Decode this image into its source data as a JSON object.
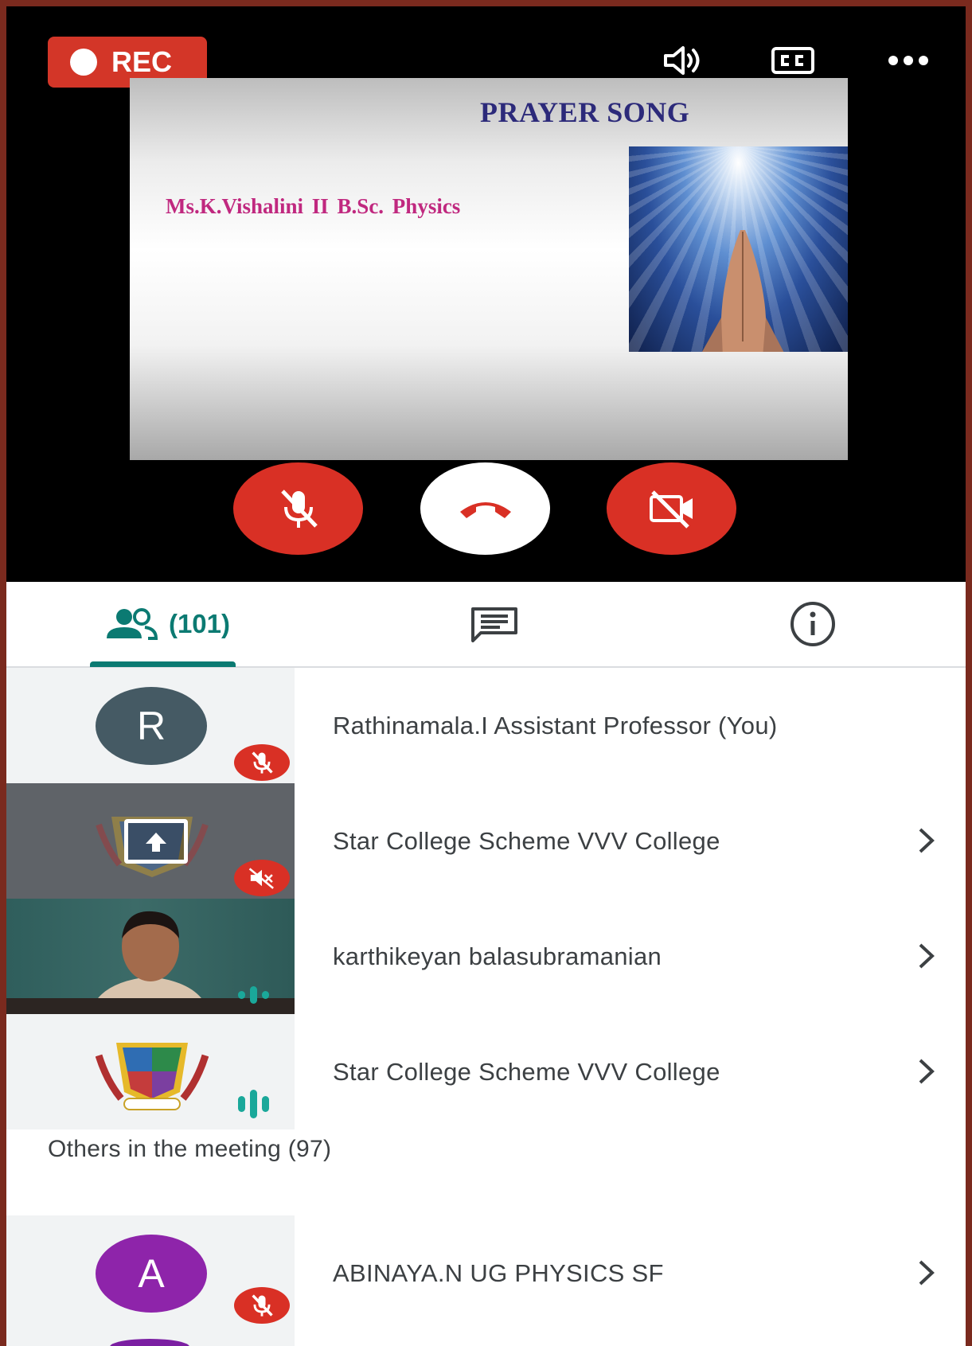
{
  "recording": {
    "label": "REC"
  },
  "slide": {
    "title": "PRAYER SONG",
    "subtitle": "Ms.K.Vishalini  II B.Sc. Physics"
  },
  "tabs": {
    "people_count": "(101)"
  },
  "participants": [
    {
      "initial": "R",
      "name": "Rathinamala.I Assistant Professor (You)",
      "avatar_color": "#455a64",
      "status": "muted"
    },
    {
      "name": "Star College Scheme VVV College",
      "status": "audio-off",
      "presenting": true
    },
    {
      "name": "karthikeyan balasubramanian",
      "status": "speaking"
    },
    {
      "name": "Star College Scheme VVV College",
      "status": "speaking"
    }
  ],
  "others": {
    "heading": "Others in the meeting (97)",
    "items": [
      {
        "initial": "A",
        "name": "ABINAYA.N UG PHYSICS SF",
        "avatar_color": "#8e24aa",
        "status": "muted"
      }
    ]
  },
  "colors": {
    "accent": "#0b7a72",
    "danger": "#d93025",
    "speaking": "#1aa89a"
  }
}
